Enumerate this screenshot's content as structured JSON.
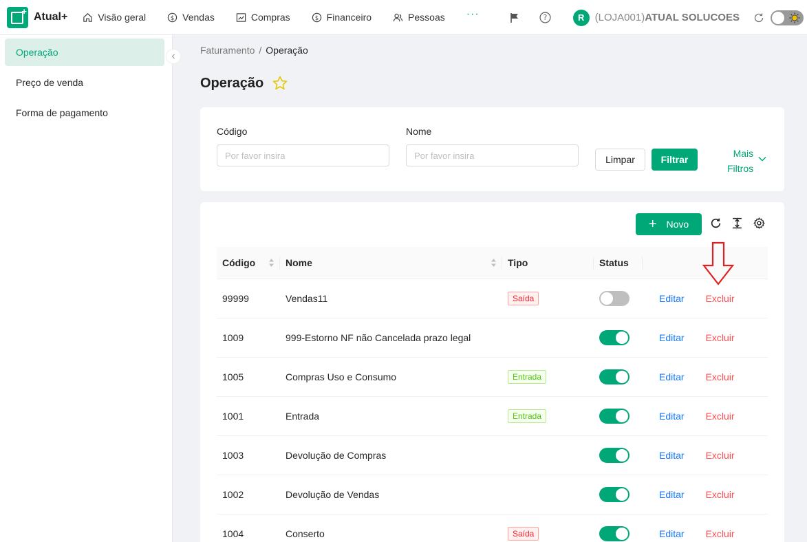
{
  "app": {
    "name": "Atual+"
  },
  "nav": [
    {
      "label": "Visão geral",
      "icon": "home-icon"
    },
    {
      "label": "Vendas",
      "icon": "dollar-circle-icon"
    },
    {
      "label": "Compras",
      "icon": "chart-line-icon"
    },
    {
      "label": "Financeiro",
      "icon": "dollar-circle-icon"
    },
    {
      "label": "Pessoas",
      "icon": "users-icon"
    }
  ],
  "nav_more": "···",
  "user": {
    "avatar_letter": "R",
    "store_code": "(LOJA001)",
    "store_name": "ATUAL SOLUCOES"
  },
  "sidebar": {
    "items": [
      {
        "label": "Operação",
        "active": true
      },
      {
        "label": "Preço de venda",
        "active": false
      },
      {
        "label": "Forma de pagamento",
        "active": false
      }
    ]
  },
  "breadcrumb": {
    "parent": "Faturamento",
    "sep": "/",
    "current": "Operação"
  },
  "page": {
    "title": "Operação"
  },
  "filters": {
    "codigo_label": "Código",
    "codigo_placeholder": "Por favor insira",
    "nome_label": "Nome",
    "nome_placeholder": "Por favor insira",
    "clear_label": "Limpar",
    "filter_label": "Filtrar",
    "more_line1": "Mais",
    "more_line2": "Filtros"
  },
  "toolbar": {
    "new_label": "Novo"
  },
  "table": {
    "columns": [
      "Código",
      "Nome",
      "Tipo",
      "Status"
    ],
    "edit_label": "Editar",
    "delete_label": "Excluir",
    "rows": [
      {
        "codigo": "99999",
        "nome": "Vendas11",
        "tipo": "Saída",
        "status": false
      },
      {
        "codigo": "1009",
        "nome": "999-Estorno NF não Cancelada prazo legal",
        "tipo": "",
        "status": true
      },
      {
        "codigo": "1005",
        "nome": "Compras Uso e Consumo",
        "tipo": "Entrada",
        "status": true
      },
      {
        "codigo": "1001",
        "nome": "Entrada",
        "tipo": "Entrada",
        "status": true
      },
      {
        "codigo": "1003",
        "nome": "Devolução de Compras",
        "tipo": "",
        "status": true
      },
      {
        "codigo": "1002",
        "nome": "Devolução de Vendas",
        "tipo": "",
        "status": true
      },
      {
        "codigo": "1004",
        "nome": "Conserto",
        "tipo": "Saída",
        "status": true
      }
    ]
  },
  "colors": {
    "accent": "#00a878",
    "edit": "#1677ff",
    "delete": "#ff4d4f",
    "annotation_arrow": "#e02020"
  }
}
